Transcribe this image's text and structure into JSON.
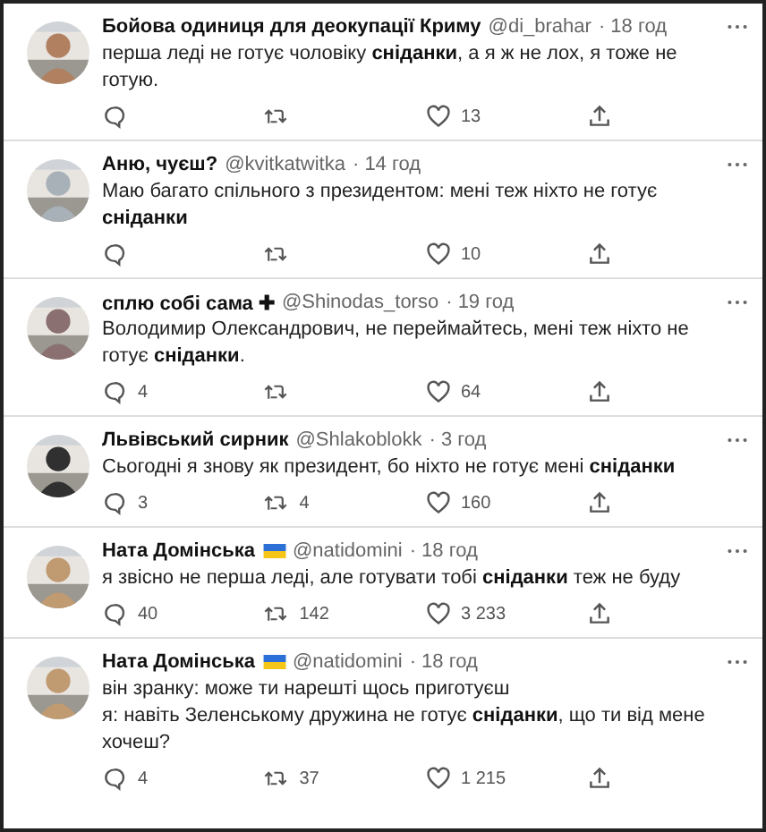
{
  "tweets": [
    {
      "name": "Бойова одиниця для деокупації Криму",
      "flag": false,
      "handle": "@di_brahar",
      "time": "· 18 год",
      "text": "перша леді не готує чоловіку **сніданки**, а я ж не лох, я тоже не готую.",
      "likes": "13"
    },
    {
      "name": "Аню, чуєш?",
      "flag": false,
      "handle": "@kvitkatwitka",
      "time": "· 14 год",
      "text": "Маю багато спільного з президентом: мені теж ніхто не готує **сніданки**",
      "likes": "10"
    },
    {
      "name": "сплю собі сама ✚",
      "flag": false,
      "handle": "@Shinodas_torso",
      "time": "· 19 год",
      "text": "Володимир Олександрович, не переймайтесь, мені теж ніхто не готує **сніданки**.",
      "replies": "4",
      "likes": "64"
    },
    {
      "name": "Львівський сирник",
      "flag": false,
      "handle": "@Shlakoblokk",
      "time": "· 3 год",
      "text": "Сьогодні я знову як президент, бо ніхто не готує мені **сніданки**",
      "replies": "3",
      "retweets": "4",
      "likes": "160"
    },
    {
      "name": "Ната Домінська",
      "flag": true,
      "handle": "@natidomini",
      "time": "· 18 год",
      "text": "я звісно не перша леді, але готувати тобі **сніданки** теж не буду",
      "replies": "40",
      "retweets": "142",
      "likes": "3 233"
    },
    {
      "name": "Ната Домінська",
      "flag": true,
      "handle": "@natidomini",
      "time": "· 18 год",
      "text": "він зранку: може ти нарешті щось приготуєш\nя: навіть Зеленському дружина не готує **сніданки**, що ти від мене хочеш?",
      "replies": "4",
      "retweets": "37",
      "likes": "1 215"
    }
  ]
}
